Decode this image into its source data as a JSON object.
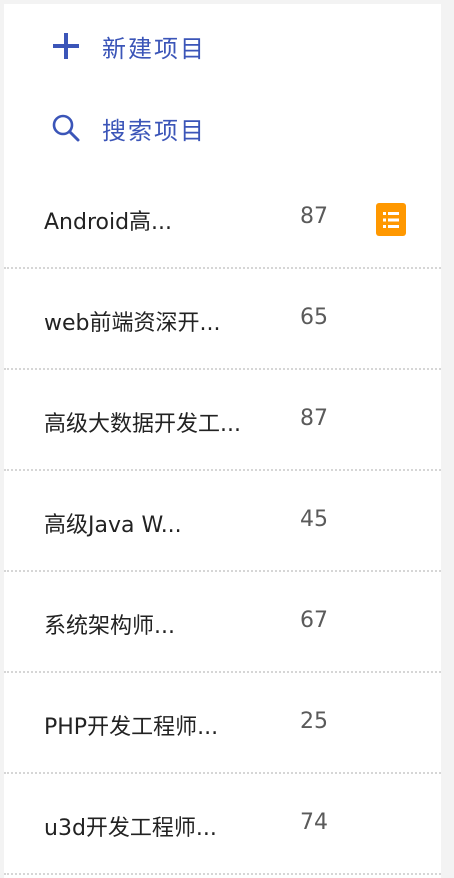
{
  "actions": {
    "new_project": {
      "label": "新建项目",
      "icon": "plus-icon"
    },
    "search_project": {
      "label": "搜索项目",
      "icon": "search-icon"
    }
  },
  "projects": [
    {
      "name": "Android高...",
      "count": "87",
      "badge_icon": "list-icon"
    },
    {
      "name": "web前端资深开...",
      "count": "65"
    },
    {
      "name": "高级大数据开发工...",
      "count": "87"
    },
    {
      "name": "高级Java W...",
      "count": "45"
    },
    {
      "name": "系统架构师...",
      "count": "67"
    },
    {
      "name": "PHP开发工程师...",
      "count": "25"
    },
    {
      "name": "u3d开发工程师...",
      "count": "74"
    }
  ],
  "colors": {
    "accent": "#3b55b8",
    "badge": "#ff9800",
    "text": "#222222",
    "count": "#5a5a5a",
    "divider": "#d6d6d6",
    "background": "#f3f3f3",
    "panel": "#ffffff"
  }
}
